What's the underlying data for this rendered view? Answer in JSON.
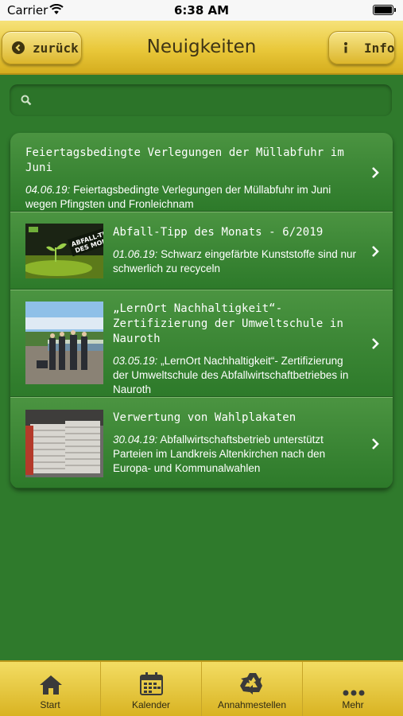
{
  "statusbar": {
    "carrier": "Carrier",
    "time": "6:38 AM"
  },
  "navbar": {
    "back_label": "zurück",
    "title": "Neuigkeiten",
    "info_label": "Info"
  },
  "search": {
    "placeholder": ""
  },
  "news": [
    {
      "title": "Feiertagsbedingte Verlegungen der Müllabfuhr im Juni",
      "date": "04.06.19:",
      "text": "Feiertagsbedingte Verlegungen der Müllabfuhr im Juni wegen Pfingsten und Fronleichnam"
    },
    {
      "title": "Abfall-Tipp des Monats - 6/2019",
      "date": "01.06.19:",
      "text": "Schwarz eingefärbte Kunststoffe sind nur schwerlich zu recyceln",
      "thumb_text": "ABFALL-TIPP DES MONATS"
    },
    {
      "title": "„LernOrt Nachhaltigkeit“- Zertifizierung der Umweltschule in Nauroth",
      "date": "03.05.19:",
      "text": "„LernOrt Nachhaltigkeit“- Zertifizierung der Umweltschule des Abfallwirtschaftbetriebes in Nauroth"
    },
    {
      "title": "Verwertung von Wahlplakaten",
      "date": "30.04.19:",
      "text": "Abfallwirtschaftsbetrieb unterstützt Parteien im Landkreis Altenkirchen nach den Europa- und Kommunalwahlen"
    }
  ],
  "tabbar": [
    {
      "label": "Start",
      "icon": "home-icon"
    },
    {
      "label": "Kalender",
      "icon": "calendar-icon"
    },
    {
      "label": "Annahmestellen",
      "icon": "recycle-icon"
    },
    {
      "label": "Mehr",
      "icon": "more-icon"
    }
  ],
  "colors": {
    "background": "#2f7a2c",
    "navbar": "#e9c83a",
    "tabbar": "#e7c536",
    "text_dark": "#3e3416"
  }
}
